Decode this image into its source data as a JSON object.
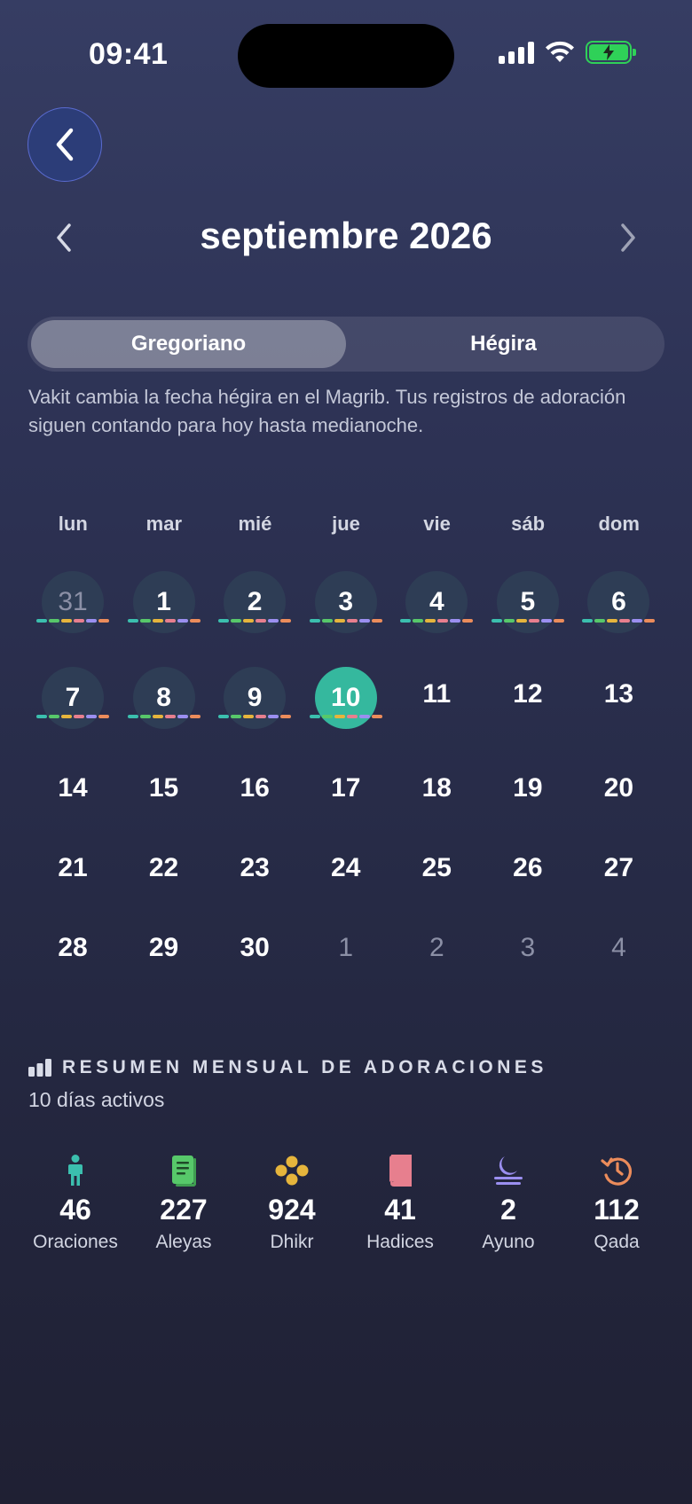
{
  "status_bar": {
    "time": "09:41"
  },
  "header": {
    "month_title": "septiembre 2026"
  },
  "calendar_mode": {
    "options": [
      "Gregoriano",
      "Hégira"
    ],
    "selected": "Gregoriano"
  },
  "note": "Vakit cambia la fecha hégira en el Magrib. Tus registros de adoración siguen contando para hoy hasta medianoche.",
  "weekdays": [
    "lun",
    "mar",
    "mié",
    "jue",
    "vie",
    "sáb",
    "dom"
  ],
  "weeks": [
    [
      {
        "d": "31",
        "t": "logged-other"
      },
      {
        "d": "1",
        "t": "logged"
      },
      {
        "d": "2",
        "t": "logged"
      },
      {
        "d": "3",
        "t": "logged"
      },
      {
        "d": "4",
        "t": "logged"
      },
      {
        "d": "5",
        "t": "logged"
      },
      {
        "d": "6",
        "t": "logged"
      }
    ],
    [
      {
        "d": "7",
        "t": "logged"
      },
      {
        "d": "8",
        "t": "logged"
      },
      {
        "d": "9",
        "t": "logged"
      },
      {
        "d": "10",
        "t": "today"
      },
      {
        "d": "11",
        "t": "plain"
      },
      {
        "d": "12",
        "t": "plain"
      },
      {
        "d": "13",
        "t": "plain"
      }
    ],
    [
      {
        "d": "14",
        "t": "plain"
      },
      {
        "d": "15",
        "t": "plain"
      },
      {
        "d": "16",
        "t": "plain"
      },
      {
        "d": "17",
        "t": "plain"
      },
      {
        "d": "18",
        "t": "plain"
      },
      {
        "d": "19",
        "t": "plain"
      },
      {
        "d": "20",
        "t": "plain"
      }
    ],
    [
      {
        "d": "21",
        "t": "plain"
      },
      {
        "d": "22",
        "t": "plain"
      },
      {
        "d": "23",
        "t": "plain"
      },
      {
        "d": "24",
        "t": "plain"
      },
      {
        "d": "25",
        "t": "plain"
      },
      {
        "d": "26",
        "t": "plain"
      },
      {
        "d": "27",
        "t": "plain"
      }
    ],
    [
      {
        "d": "28",
        "t": "plain"
      },
      {
        "d": "29",
        "t": "plain"
      },
      {
        "d": "30",
        "t": "plain"
      },
      {
        "d": "1",
        "t": "other"
      },
      {
        "d": "2",
        "t": "other"
      },
      {
        "d": "3",
        "t": "other"
      },
      {
        "d": "4",
        "t": "other"
      }
    ]
  ],
  "summary": {
    "title": "RESUMEN MENSUAL DE ADORACIONES",
    "subtitle": "10 días activos",
    "stats": [
      {
        "value": "46",
        "label": "Oraciones",
        "icon": "person-icon",
        "color": "#3bbfae"
      },
      {
        "value": "227",
        "label": "Aleyas",
        "icon": "quran-book-icon",
        "color": "#57c86a"
      },
      {
        "value": "924",
        "label": "Dhikr",
        "icon": "beads-icon",
        "color": "#e6b53c"
      },
      {
        "value": "41",
        "label": "Hadices",
        "icon": "hadith-book-icon",
        "color": "#e77f8e"
      },
      {
        "value": "2",
        "label": "Ayuno",
        "icon": "moon-icon",
        "color": "#9b8ff0"
      },
      {
        "value": "112",
        "label": "Qada",
        "icon": "history-icon",
        "color": "#ec8c5b"
      }
    ]
  },
  "colors": {
    "today": "#35b89e",
    "logged_bubble": "#2e3d55",
    "dot_palette": [
      "#3bbfae",
      "#57c86a",
      "#e6b53c",
      "#e77f8e",
      "#9b8ff0",
      "#ec8c5b"
    ]
  }
}
